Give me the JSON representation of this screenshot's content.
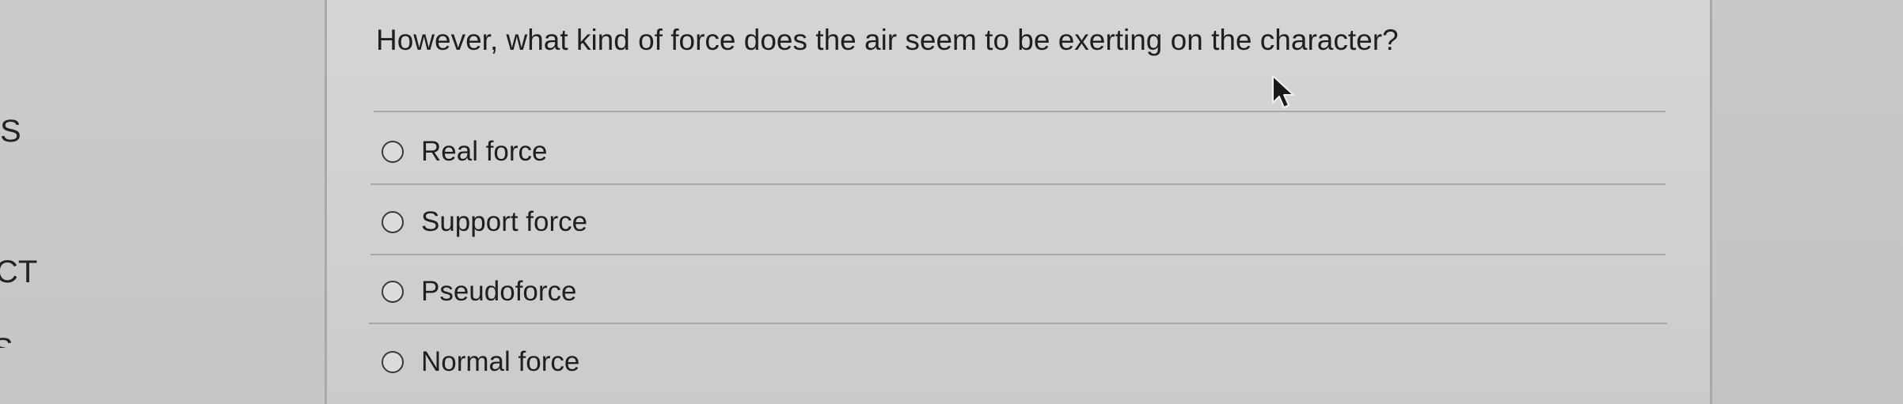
{
  "left_edge_text": [
    "S",
    "CT",
    "S"
  ],
  "question": {
    "text": "However, what kind of force does the air seem to be exerting on the character?"
  },
  "options": [
    {
      "label": "Real force",
      "selected": false
    },
    {
      "label": "Support force",
      "selected": false
    },
    {
      "label": "Pseudoforce",
      "selected": false
    },
    {
      "label": "Normal force",
      "selected": false
    }
  ],
  "icons": {
    "radio": "radio-circle-icon",
    "pointer": "mouse-pointer-icon"
  },
  "colors": {
    "background": "#d3d3d5",
    "text": "#1f1f22",
    "divider": "#a8a8ab"
  }
}
